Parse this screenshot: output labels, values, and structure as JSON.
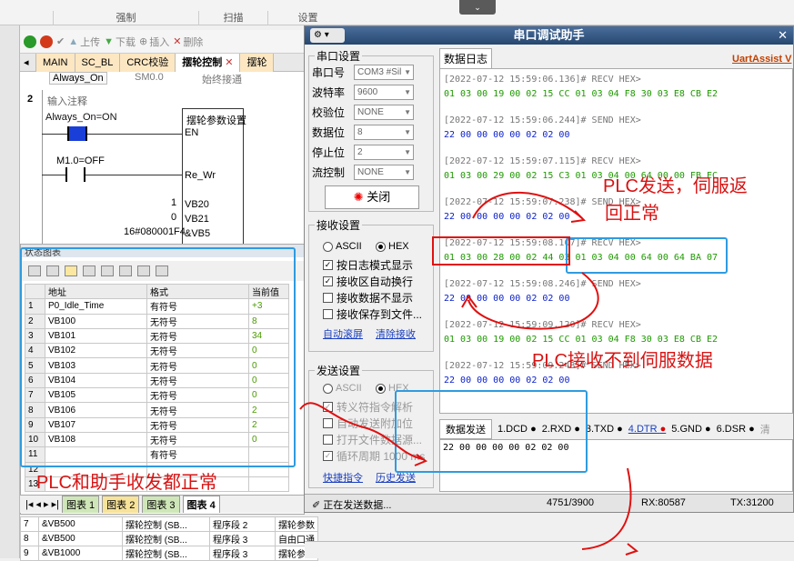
{
  "ribbon": {
    "groups": [
      "强制",
      "扫描",
      "设置"
    ]
  },
  "toolbar": {
    "up": "上传",
    "down": "下载",
    "insert": "插入",
    "delete": "删除"
  },
  "program_tabs": [
    "MAIN",
    "SC_BL",
    "CRC校验",
    "摆轮控制",
    "摆轮"
  ],
  "ladder": {
    "top_cell1": "Always_On",
    "top_cell2": "SM0.0",
    "top_cell3": "始终接通",
    "network_num": "2",
    "network_comment": "输入注释",
    "contact1": "Always_On=ON",
    "contact2": "M1.0=OFF",
    "block_title": "摆轮参数设置",
    "pin_en": "EN",
    "pin_rewr": "Re_Wr",
    "in1_val": "1",
    "in1": "VB20",
    "in2_val": "0",
    "in2": "VB21",
    "in3_val": "16#080001F4",
    "in3": "&VB5"
  },
  "status_chart": {
    "title": "状态图表",
    "columns": [
      "地址",
      "格式",
      "当前值"
    ],
    "rows": [
      {
        "n": "1",
        "addr": "P0_Idle_Time",
        "fmt": "有符号",
        "val": "+3"
      },
      {
        "n": "2",
        "addr": "VB100",
        "fmt": "无符号",
        "val": "8"
      },
      {
        "n": "3",
        "addr": "VB101",
        "fmt": "无符号",
        "val": "34"
      },
      {
        "n": "4",
        "addr": "VB102",
        "fmt": "无符号",
        "val": "0"
      },
      {
        "n": "5",
        "addr": "VB103",
        "fmt": "无符号",
        "val": "0"
      },
      {
        "n": "6",
        "addr": "VB104",
        "fmt": "无符号",
        "val": "0"
      },
      {
        "n": "7",
        "addr": "VB105",
        "fmt": "无符号",
        "val": "0"
      },
      {
        "n": "8",
        "addr": "VB106",
        "fmt": "无符号",
        "val": "2"
      },
      {
        "n": "9",
        "addr": "VB107",
        "fmt": "无符号",
        "val": "2"
      },
      {
        "n": "10",
        "addr": "VB108",
        "fmt": "无符号",
        "val": "0"
      },
      {
        "n": "11",
        "addr": "",
        "fmt": "有符号",
        "val": ""
      },
      {
        "n": "12",
        "addr": "",
        "fmt": "",
        "val": ""
      },
      {
        "n": "13",
        "addr": "",
        "fmt": "",
        "val": ""
      }
    ],
    "tabs": [
      "图表 1",
      "图表 2",
      "图表 3",
      "图表 4"
    ]
  },
  "bottom_table": [
    {
      "n": "7",
      "addr": "&VB500",
      "block": "摆轮控制 (SB...",
      "seg": "程序段 2",
      "desc": "摆轮参数"
    },
    {
      "n": "8",
      "addr": "&VB500",
      "block": "摆轮控制 (SB...",
      "seg": "程序段 3",
      "desc": "自由口通"
    },
    {
      "n": "9",
      "addr": "&VB1000",
      "block": "摆轮控制 (SB...",
      "seg": "程序段 3",
      "desc": "摆轮参数"
    }
  ],
  "serial": {
    "title": "串口调试助手",
    "brand": "UartAssist V",
    "port_group": "串口设置",
    "port_labels": [
      "串口号",
      "波特率",
      "校验位",
      "数据位",
      "停止位",
      "流控制"
    ],
    "port_values": [
      "COM3 #Sil",
      "9600",
      "NONE",
      "8",
      "2",
      "NONE"
    ],
    "close_btn": "关闭",
    "recv_group": "接收设置",
    "recv_ascii": "ASCII",
    "recv_hex": "HEX",
    "recv_opts": [
      "按日志模式显示",
      "接收区自动换行",
      "接收数据不显示",
      "接收保存到文件..."
    ],
    "recv_links": [
      "自动滚屏",
      "清除接收"
    ],
    "send_group": "发送设置",
    "send_ascii": "ASCII",
    "send_hex": "HEX",
    "send_opts": [
      "转义符指令解析",
      "自动发送附加位",
      "打开文件数据源...",
      "循环周期 1000 ms"
    ],
    "send_links": [
      "快捷指令",
      "历史发送"
    ],
    "log_tab": "数据日志",
    "log": [
      {
        "ts": "[2022-07-12 15:59:06.136]# RECV HEX>",
        "data": "01 03 00 19 00 02 15 CC 01 03 04 F8 30 03 E8 CB E2",
        "dir": "rx"
      },
      {
        "ts": "[2022-07-12 15:59:06.244]# SEND HEX>",
        "data": "22 00 00 00 00 02 02 00",
        "dir": "tx"
      },
      {
        "ts": "[2022-07-12 15:59:07.115]# RECV HEX>",
        "data": "01 03 00 29 00 02 15 C3 01 03 04 00 64 00 00 FB EC",
        "dir": "rx"
      },
      {
        "ts": "[2022-07-12 15:59:07.238]# SEND HEX>",
        "data": "22 00 00 00 00 02 02 00",
        "dir": "tx"
      },
      {
        "ts": "[2022-07-12 15:59:08.107]# RECV HEX>",
        "data": "01 03 00 28 00 02 44 03 01 03 04 00 64 00 64 BA 07",
        "dir": "rx"
      },
      {
        "ts": "[2022-07-12 15:59:08.246]# SEND HEX>",
        "data": "22 00 00 00 00 02 02 00",
        "dir": "tx"
      },
      {
        "ts": "[2022-07-12 15:59:09.120]# RECV HEX>",
        "data": "01 03 00 19 00 02 15 CC 01 03 04 F8 30 03 E8 CB E2",
        "dir": "rx"
      },
      {
        "ts": "[2022-07-12 15:59:09.243]# SEND HEX>",
        "data": "22 00 00 00 00 02 02 00",
        "dir": "tx"
      }
    ],
    "send_tab": "数据发送",
    "pins": [
      "1.DCD",
      "2.RXD",
      "3.TXD",
      "4.DTR",
      "5.GND",
      "6.DSR",
      "清"
    ],
    "send_text": "22 00 00 00 00 02 02 00",
    "status_text": "正在发送数据...",
    "status_count": "4751/3900",
    "rx": "RX:80587",
    "tx": "TX:31200"
  },
  "annotations": {
    "a1": "PLC发送，伺服返",
    "a2": "回正常",
    "a3": "PLC接收不到伺服数据",
    "a4": "PLC和助手收发都正常"
  },
  "colors": {
    "annot_red": "#d81313",
    "annot_blue": "#2f9be0",
    "rx_green": "#1e9a00",
    "tx_blue": "#0a1fcc"
  }
}
